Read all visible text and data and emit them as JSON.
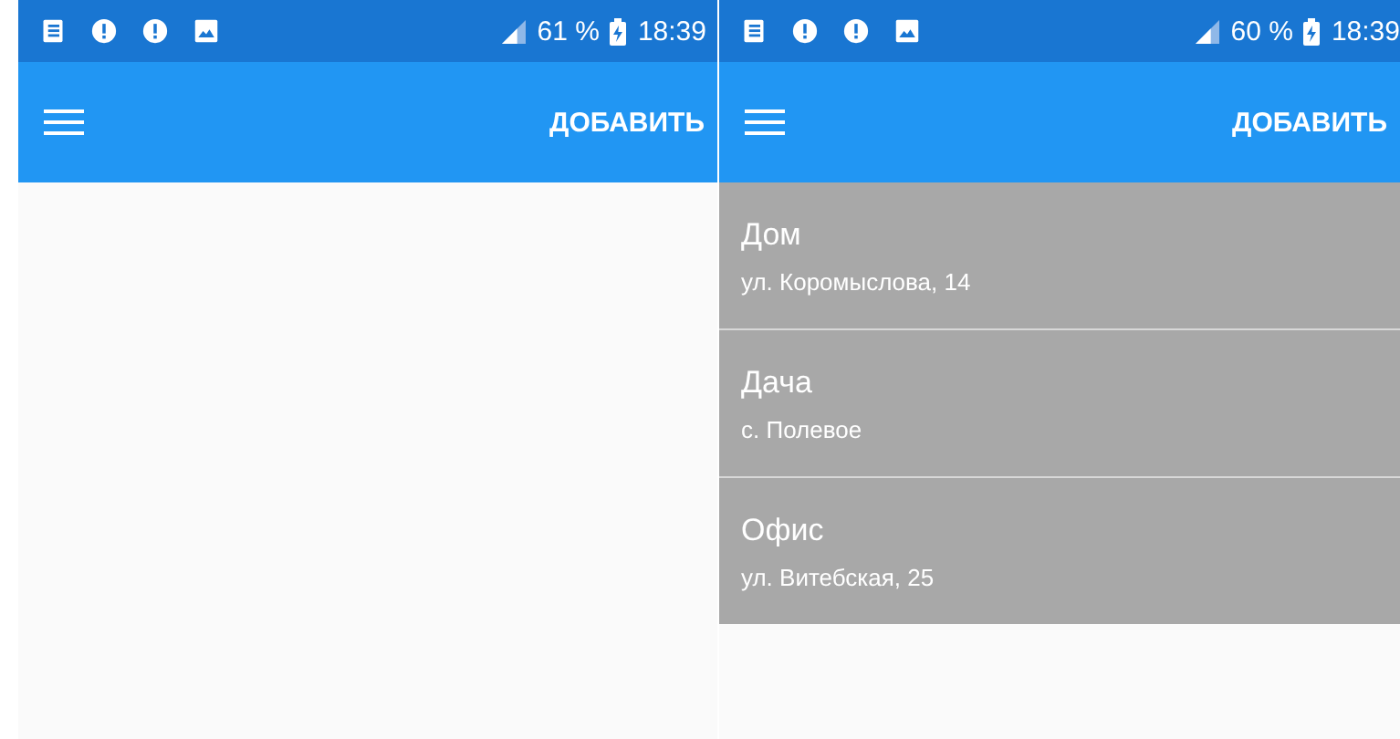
{
  "screens": [
    {
      "status_bar": {
        "battery": "61 %",
        "time": "18:39"
      },
      "app_bar": {
        "action": "ДОБАВИТЬ"
      }
    },
    {
      "status_bar": {
        "battery": "60 %",
        "time": "18:39"
      },
      "app_bar": {
        "action": "ДОБАВИТЬ"
      },
      "places": [
        {
          "name": "Дом",
          "address": "ул. Коромыслова, 14"
        },
        {
          "name": "Дача",
          "address": "с. Полевое"
        },
        {
          "name": "Офис",
          "address": "ул. Витебская, 25"
        }
      ]
    }
  ]
}
